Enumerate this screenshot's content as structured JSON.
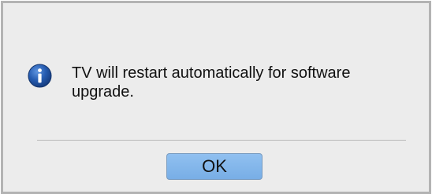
{
  "dialog": {
    "icon": "info-icon",
    "message": "TV will restart automatically for software upgrade.",
    "ok_label": "OK"
  },
  "colors": {
    "panel_background": "#ececec",
    "panel_border": "#b3b3b3",
    "button_fill": "#84b6ea",
    "icon_blue": "#1f4f9c"
  }
}
